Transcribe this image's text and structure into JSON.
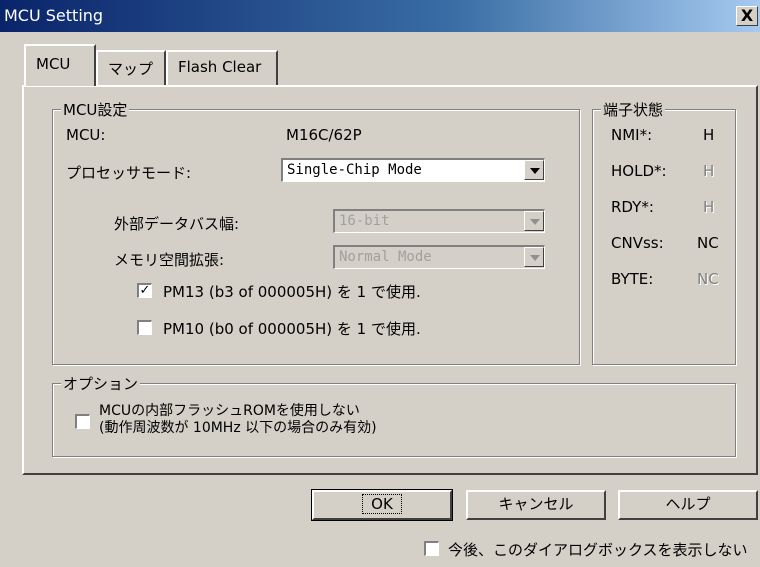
{
  "window": {
    "title": "MCU Setting",
    "close_label": "X"
  },
  "tabs": [
    "MCU",
    "マップ",
    "Flash Clear"
  ],
  "mcu_group": {
    "legend": "MCU設定",
    "mcu_label": "MCU:",
    "mcu_value": "M16C/62P",
    "processor_mode_label": "プロセッサモード:",
    "processor_mode_value": "Single-Chip Mode",
    "bus_width_label": "外部データバス幅:",
    "bus_width_value": "16-bit",
    "memory_expansion_label": "メモリ空間拡張:",
    "memory_expansion_value": "Normal Mode",
    "pm13_label": "PM13 (b3 of 000005H) を 1 で使用.",
    "pm13_checked": true,
    "pm10_label": "PM10 (b0 of 000005H) を 1 で使用.",
    "pm10_checked": false
  },
  "pin_group": {
    "legend": "端子状態",
    "pins": [
      {
        "name": "NMI*:",
        "value": "H"
      },
      {
        "name": "HOLD*:",
        "value": "H"
      },
      {
        "name": "RDY*:",
        "value": "H"
      },
      {
        "name": "CNVss:",
        "value": "NC"
      },
      {
        "name": "BYTE:",
        "value": "NC"
      }
    ]
  },
  "option_group": {
    "legend": "オプション",
    "flash_line1": "MCUの内部フラッシュROMを使用しない",
    "flash_line2": "(動作周波数が 10MHz 以下の場合のみ有効)",
    "flash_checked": false
  },
  "buttons": {
    "ok": "OK",
    "cancel": "キャンセル",
    "help": "ヘルプ"
  },
  "dont_show": {
    "label": "今後、このダイアログボックスを表示しない",
    "checked": false
  },
  "colors": {
    "titlebar_start": "#0a246a",
    "titlebar_end": "#a6caf0",
    "face": "#d4d0c8"
  }
}
